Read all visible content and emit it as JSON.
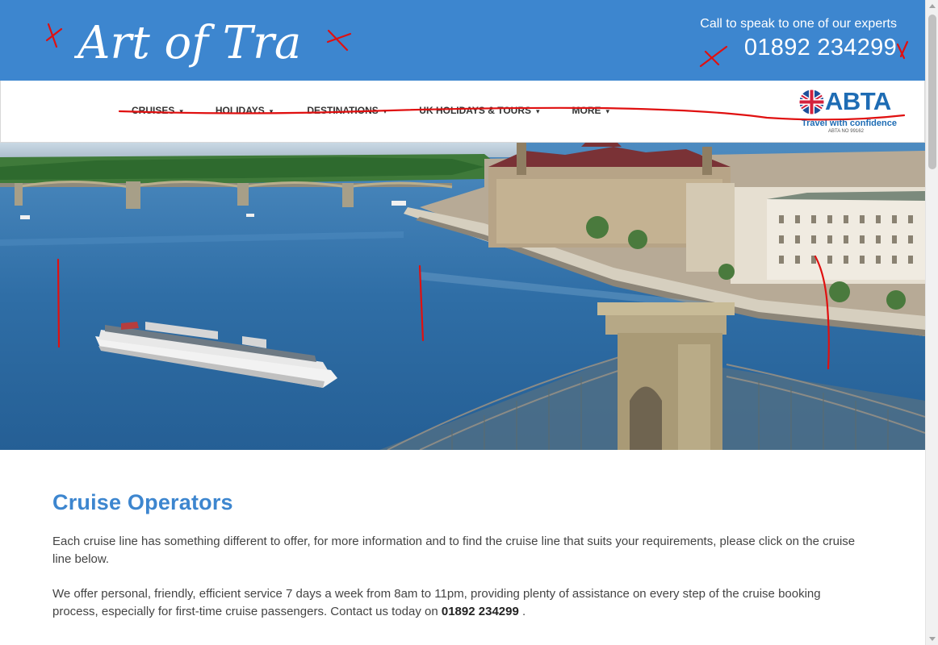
{
  "header": {
    "logo_text": "Art of Travel",
    "call_text": "Call to speak to one of our experts",
    "phone": "01892 234299"
  },
  "nav": {
    "items": [
      {
        "label": "CRUISES"
      },
      {
        "label": "HOLIDAYS"
      },
      {
        "label": "DESTINATIONS"
      },
      {
        "label": "UK HOLIDAYS & TOURS"
      },
      {
        "label": "MORE"
      }
    ],
    "abta": {
      "word": "ABTA",
      "tagline": "Travel with confidence",
      "number": "ABTA NO 99162"
    }
  },
  "hero": {
    "image": "budapest-danube-river-cruise"
  },
  "content": {
    "title": "Cruise Operators",
    "paragraph1": "Each cruise line has something different to offer, for more information and to find the cruise line that suits your requirements, please click on the cruise line below.",
    "paragraph2_text": "We offer personal, friendly, efficient service 7 days a week from 8am to 11pm, providing plenty of assistance on every step of the cruise booking process, especially for first-time cruise passengers. Contact us today on ",
    "paragraph2_phone": "01892 234299",
    "paragraph2_end": " ."
  },
  "colors": {
    "brand_blue": "#3d86cf",
    "abta_blue": "#1e6cb4",
    "annotation_red": "#e01010"
  }
}
